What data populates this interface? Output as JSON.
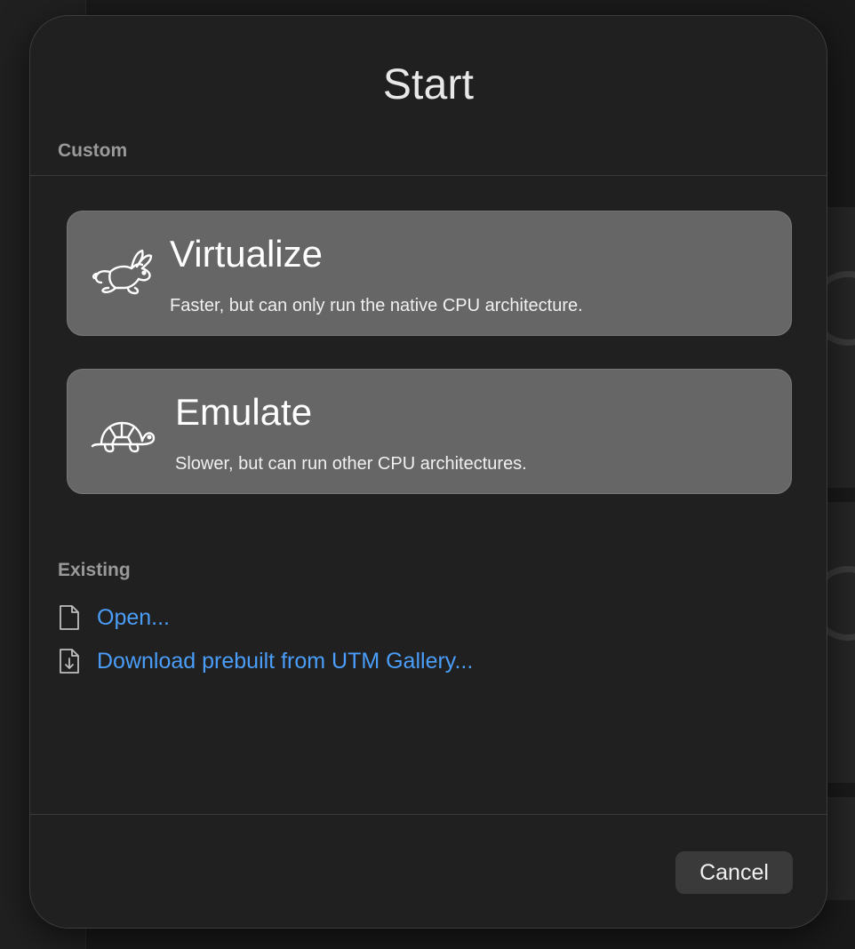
{
  "dialog": {
    "title": "Start"
  },
  "custom": {
    "label": "Custom",
    "options": [
      {
        "title": "Virtualize",
        "subtitle": "Faster, but can only run the native CPU architecture.",
        "icon": "hare-icon"
      },
      {
        "title": "Emulate",
        "subtitle": "Slower, but can run other CPU architectures.",
        "icon": "tortoise-icon"
      }
    ]
  },
  "existing": {
    "label": "Existing",
    "links": [
      {
        "label": "Open...",
        "icon": "document-icon"
      },
      {
        "label": "Download prebuilt from UTM Gallery...",
        "icon": "document-download-icon"
      }
    ]
  },
  "footer": {
    "cancel_label": "Cancel"
  },
  "colors": {
    "link": "#4a9df8",
    "option_bg": "#666666",
    "dialog_bg": "#202020"
  }
}
